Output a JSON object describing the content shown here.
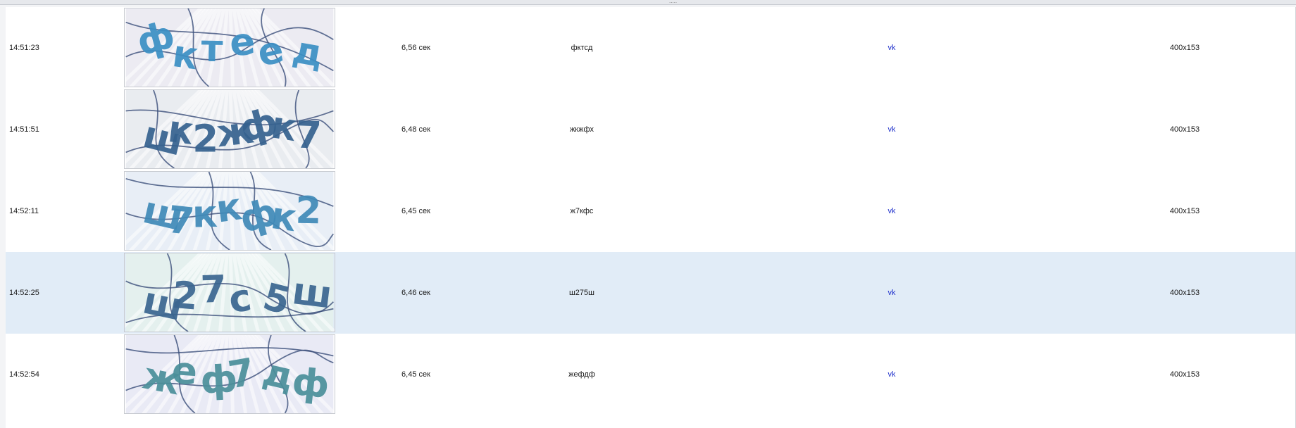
{
  "splitter": {
    "grip": "....."
  },
  "rows": [
    {
      "time": "14:51:23",
      "duration": "6,56 сек",
      "answer": "фктсд",
      "service": "vk",
      "size": "400x153",
      "captcha_text": "фктеед",
      "selected": false
    },
    {
      "time": "14:51:51",
      "duration": "6,48 сек",
      "answer": "жкжфх",
      "service": "vk",
      "size": "400x153",
      "captcha_text": "шк2жфк7",
      "selected": false
    },
    {
      "time": "14:52:11",
      "duration": "6,45 сек",
      "answer": "ж7кфс",
      "service": "vk",
      "size": "400x153",
      "captcha_text": "ш7ккфк2",
      "selected": false
    },
    {
      "time": "14:52:25",
      "duration": "6,46 сек",
      "answer": "ш275ш",
      "service": "vk",
      "size": "400x153",
      "captcha_text": "ш27с5ш",
      "selected": true
    },
    {
      "time": "14:52:54",
      "duration": "6,45 сек",
      "answer": "жефдф",
      "service": "vk",
      "size": "400x153",
      "captcha_text": "жеф7дф",
      "selected": false
    }
  ],
  "colors": {
    "selected_row": "#e1ecf7",
    "link": "#2233cc",
    "captcha_ink": [
      "#3b8fc4",
      "#35628f",
      "#3f8ab8",
      "#3a6690",
      "#4a8f9a"
    ],
    "captcha_bg": [
      "#ecebf2",
      "#e9ecf0",
      "#e8eef6",
      "#e4f0ee",
      "#e9eaf5"
    ]
  }
}
